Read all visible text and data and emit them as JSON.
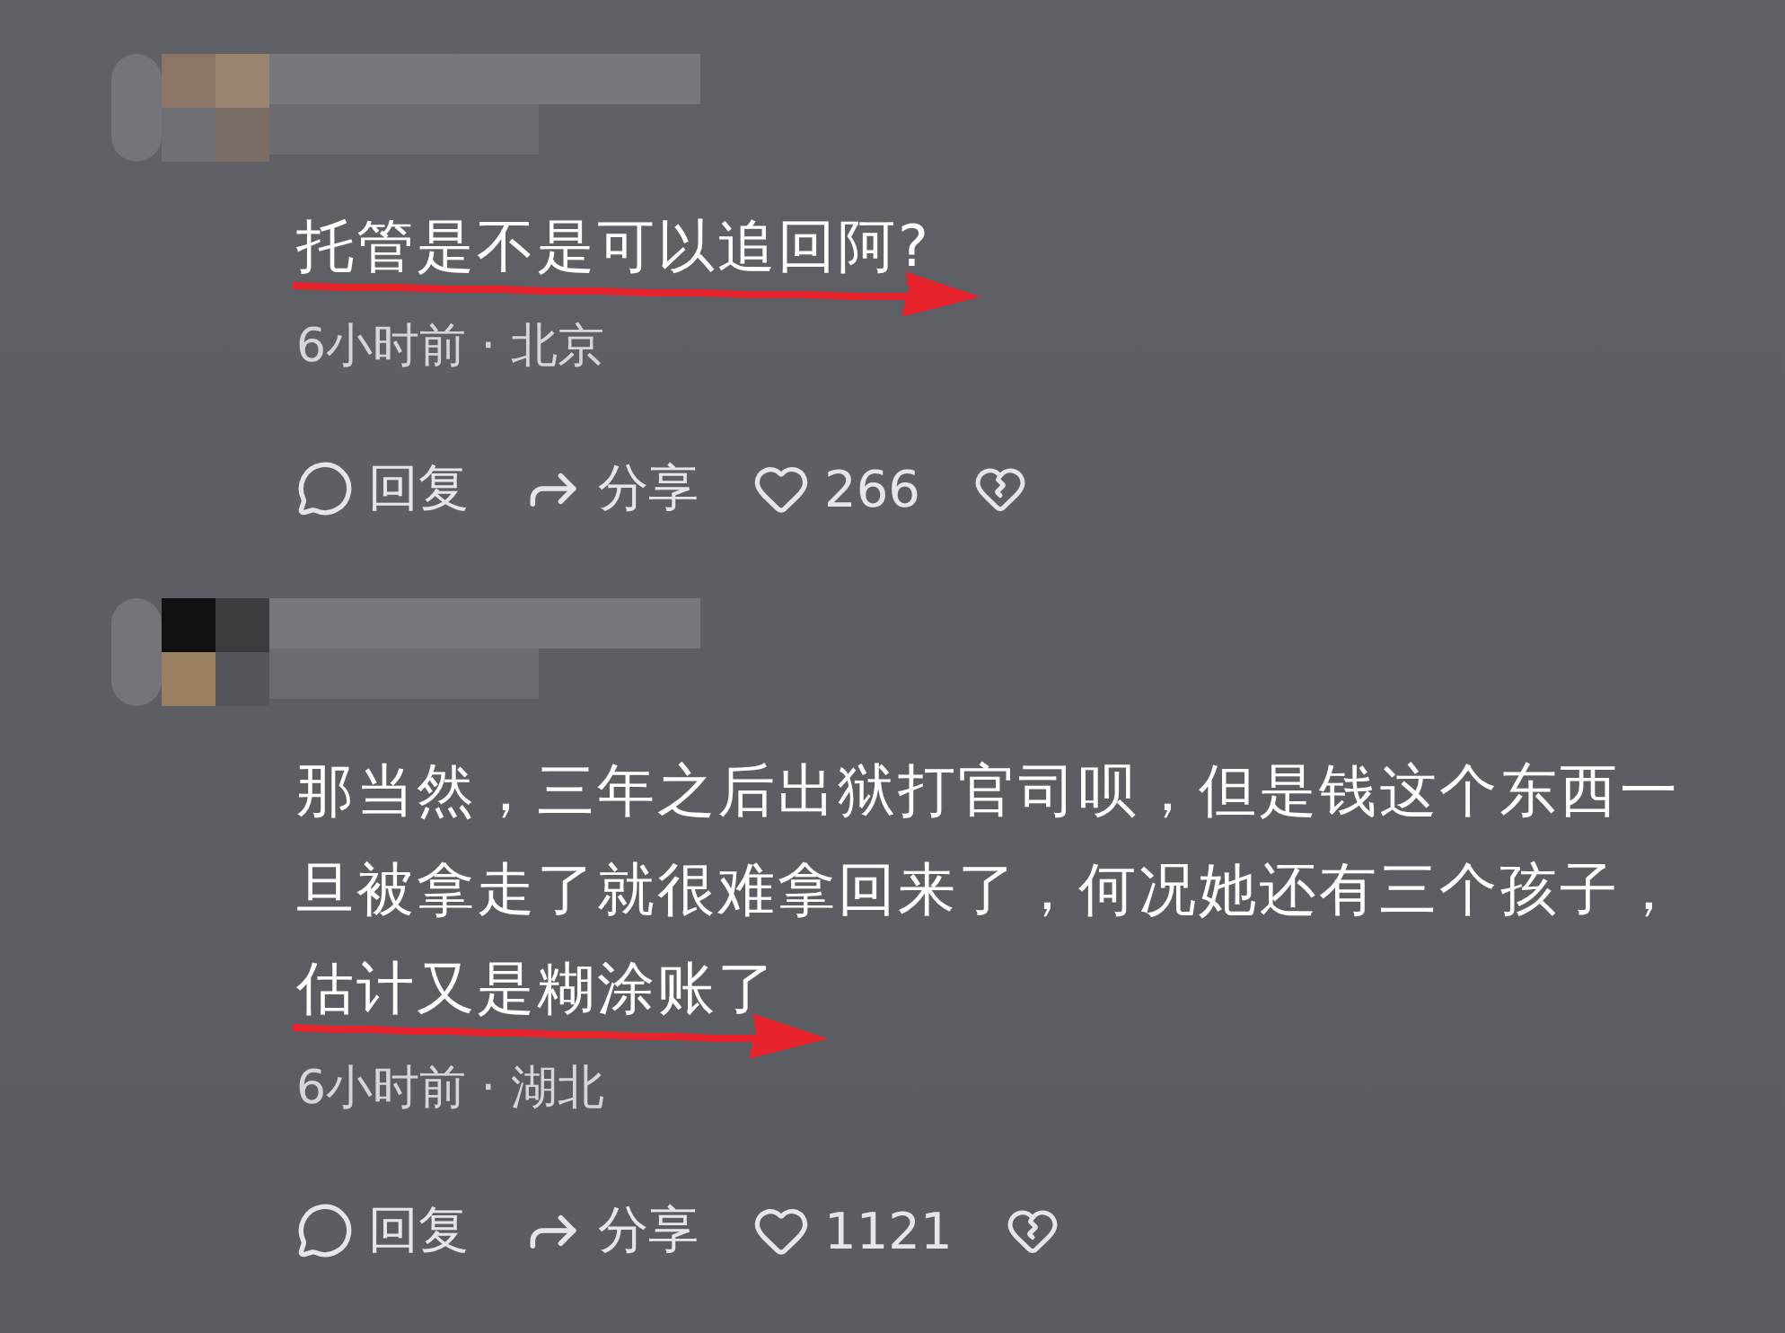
{
  "comments": [
    {
      "text": "托管是不是可以追回阿?",
      "meta": "6小时前 · 北京",
      "annotated": true,
      "reply": "回复",
      "share": "分享",
      "likes": "266"
    },
    {
      "text": "那当然，三年之后出狱打官司呗，但是钱这个东西一旦被拿走了就很难拿回来了，何况她还有三个孩子，估计又是糊涂账了",
      "meta": "6小时前 · 湖北",
      "annotated": true,
      "reply": "回复",
      "share": "分享",
      "likes": "1121"
    }
  ]
}
